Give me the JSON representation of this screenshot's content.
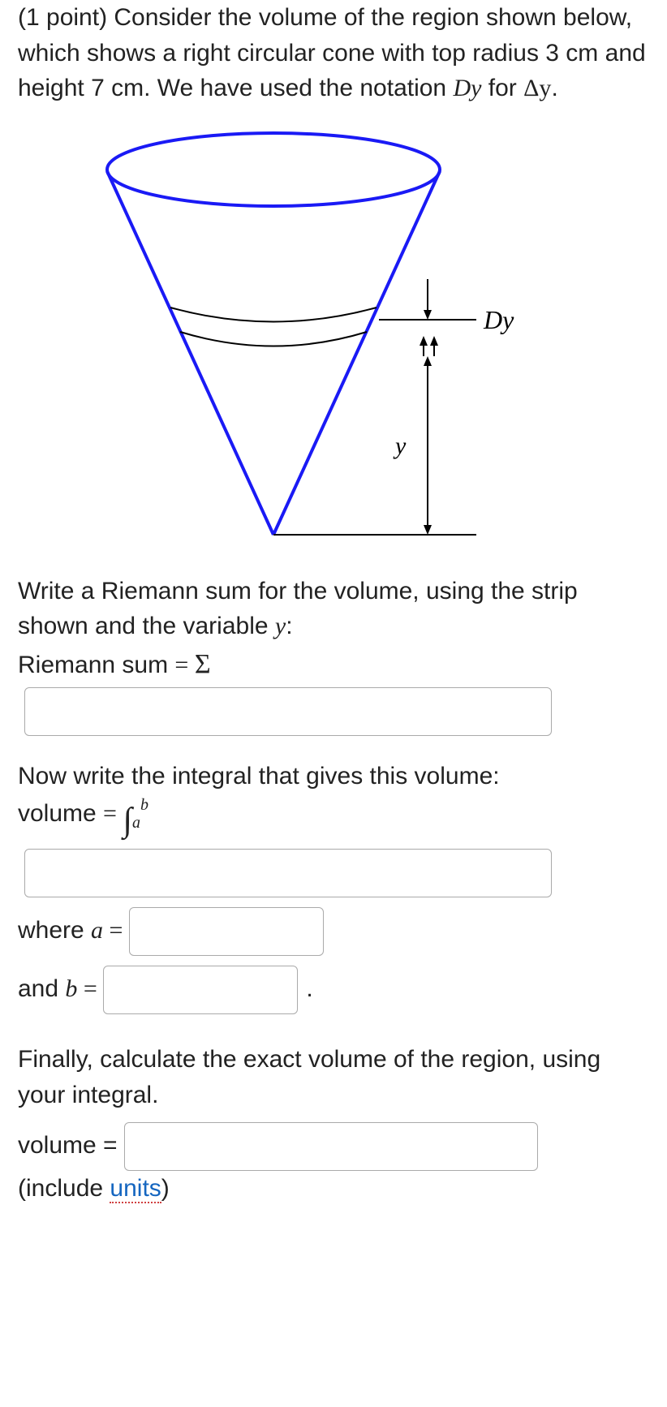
{
  "problem": {
    "intro_pre": "(1 point) Consider the volume of the region shown below, which shows a right circular cone with top radius 3 cm and height 7 cm. We have used the notation ",
    "intro_Dy": "Dy",
    "intro_mid": " for ",
    "intro_delta": "Δy",
    "intro_post": "."
  },
  "diagram": {
    "label_Dy": "Dy",
    "label_y": "y"
  },
  "riemann": {
    "prompt_pre": "Write a Riemann sum for the volume, using the strip shown and the variable ",
    "prompt_var": "y",
    "prompt_post": ":",
    "label": "Riemann sum ",
    "equals": "= ",
    "sigma": "Σ"
  },
  "integral": {
    "prompt": "Now write the integral that gives this volume:",
    "label": "volume ",
    "equals": "= ",
    "int_symbol": "∫",
    "sub": "a",
    "sup": "b",
    "where_a": "where ",
    "a_var": "a",
    "a_eq": " = ",
    "and_b": "and ",
    "b_var": "b",
    "b_eq": " = ",
    "period": "."
  },
  "final": {
    "prompt": "Finally, calculate the exact volume of the region, using your integral.",
    "label": "volume = ",
    "include_pre": "(include ",
    "units": "units",
    "include_post": ")"
  },
  "inputs": {
    "riemann_sum": "",
    "integrand": "",
    "a": "",
    "b": "",
    "volume": ""
  }
}
